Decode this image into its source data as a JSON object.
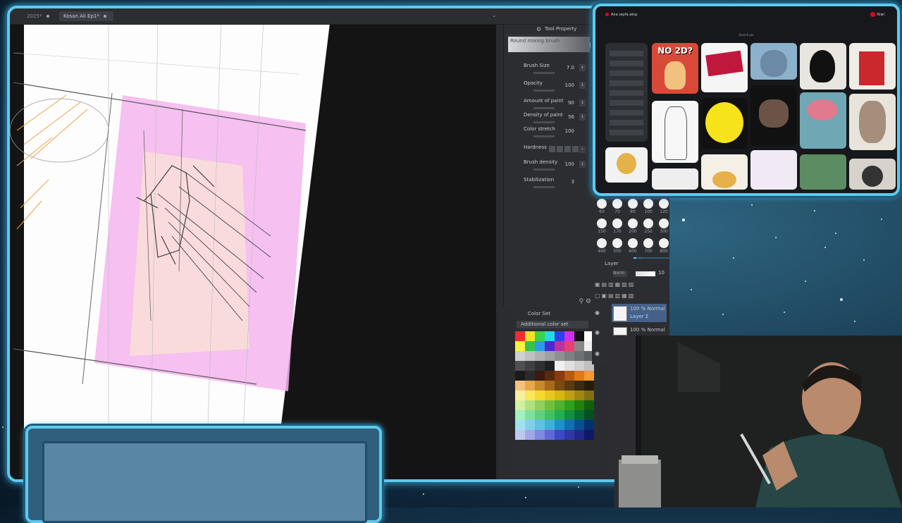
{
  "tabs": [
    {
      "label": "2025*",
      "active": false
    },
    {
      "label": "Kosan Ali Ep1*",
      "active": true
    }
  ],
  "tool_property": {
    "title": "Tool Property",
    "brush_name": "Round mixing brush",
    "properties": [
      {
        "label": "Brush Size",
        "value": "7.0"
      },
      {
        "label": "Opacity",
        "value": "100"
      },
      {
        "label": "Amount of paint",
        "value": "90"
      },
      {
        "label": "Density of paint",
        "value": "56"
      },
      {
        "label": "Color stretch",
        "value": "100"
      },
      {
        "label": "Hardness",
        "value": ""
      },
      {
        "label": "Brush density",
        "value": "100"
      },
      {
        "label": "Stabilization",
        "value": "3"
      }
    ]
  },
  "brush_sizes": [
    "60",
    "70",
    "80",
    "100",
    "120",
    "150",
    "170",
    "200",
    "250",
    "300",
    "400",
    "500",
    "600",
    "700",
    "800"
  ],
  "color_set": {
    "title": "Color Set",
    "dropdown": "Additional color set"
  },
  "layers": {
    "title": "Layer",
    "blend": "Norm",
    "opacity_label": "10",
    "rows": [
      {
        "mode": "100 % Normal",
        "name": "Layer 2",
        "selected": true
      },
      {
        "mode": "100 % Normal",
        "name": "",
        "selected": false
      }
    ]
  },
  "pinterest": {
    "brand": "Ana sayfa akışı",
    "search": "Search pin",
    "profile": "Kiwi",
    "pin1_text": "NO 2D?",
    "accent": "#e60023"
  },
  "colors": {
    "frame": "#5fc9ee",
    "pink_wash": "#f5b5ef"
  }
}
